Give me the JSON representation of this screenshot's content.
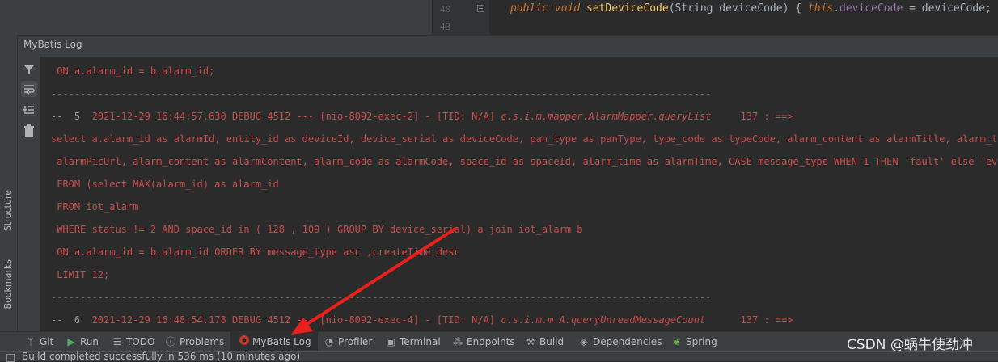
{
  "editor": {
    "line_numbers": [
      "40",
      "43"
    ],
    "code": {
      "kw1": "public",
      "kw2": "void",
      "method": "setDeviceCode",
      "params": "(String deviceCode) { ",
      "this": "this",
      "dot_field": ".",
      "field": "deviceCode",
      "assign": " = deviceCode; }"
    }
  },
  "left_strip": {
    "structure_label": "Structure",
    "bookmarks_label": "Bookmarks"
  },
  "panel": {
    "title": "MyBatis Log"
  },
  "log": {
    "lines": [
      " ON a.alarm_id = b.alarm_id;",
      "-----------------------------------------------------------------------------------------------------------------",
      "",
      "select a.alarm_id as alarmId, entity_id as deviceId, device_serial as deviceCode, pan_type as panType, type_code as typeCode, alarm_content as alarmTitle, alarm_time as",
      " alarmPicUrl, alarm_content as alarmContent, alarm_code as alarmCode, space_id as spaceId, alarm_time as alarmTime, CASE message_type WHEN 1 THEN 'fault' else 'event'",
      " FROM (select MAX(alarm_id) as alarm_id",
      " FROM iot_alarm",
      " WHERE status != 2 AND space_id in ( 128 , 109 ) GROUP BY device_serial) a join iot_alarm b",
      " ON a.alarm_id = b.alarm_id ORDER BY message_type asc ,createTime desc",
      " LIMIT 12;",
      "-----------------------------------------------------------------------------------------------------------------",
      ""
    ],
    "header5": {
      "index": "--  5  ",
      "text": "2021-12-29 16:44:57.630 DEBUG 4512 --- [nio-8092-exec-2] - [TID: N/A] ",
      "method": "c.s.i.m.mapper.AlarmMapper.queryList",
      "tail": "     137 : ==>"
    },
    "header6": {
      "index": "--  6  ",
      "text": "2021-12-29 16:48:54.178 DEBUG 4512 --- [nio-8092-exec-4] - [TID: N/A] ",
      "method": "c.s.i.m.m.A.queryUnreadMessageCount",
      "tail": "      137 : ==>"
    }
  },
  "bottom_tabs": [
    {
      "label": "Git",
      "icon": "git-branch-icon"
    },
    {
      "label": "Run",
      "icon": "run-icon"
    },
    {
      "label": "TODO",
      "icon": "todo-icon"
    },
    {
      "label": "Problems",
      "icon": "problems-icon"
    },
    {
      "label": "MyBatis Log",
      "icon": "mybatis-icon"
    },
    {
      "label": "Profiler",
      "icon": "profiler-icon"
    },
    {
      "label": "Terminal",
      "icon": "terminal-icon"
    },
    {
      "label": "Endpoints",
      "icon": "endpoints-icon"
    },
    {
      "label": "Build",
      "icon": "build-icon"
    },
    {
      "label": "Dependencies",
      "icon": "dependencies-icon"
    },
    {
      "label": "Spring",
      "icon": "spring-icon"
    }
  ],
  "status": {
    "text": "Build completed successfully in 536 ms (10 minutes ago)"
  },
  "watermark": "CSDN @蜗牛使劲冲",
  "colors": {
    "sql_red": "#cc4b4b",
    "arrow_red": "#e8211b",
    "background": "#2b2b2b"
  }
}
